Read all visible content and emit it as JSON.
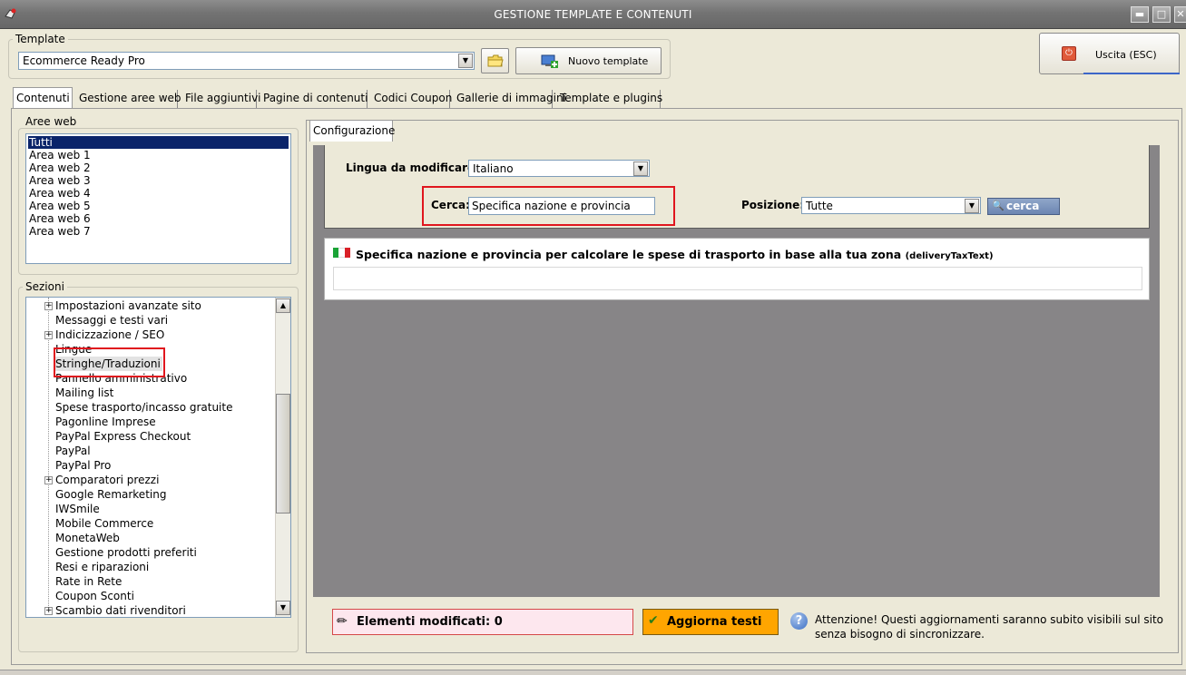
{
  "window": {
    "title": "GESTIONE TEMPLATE E CONTENUTI",
    "min_glyph": "▬",
    "max_glyph": "□",
    "close_glyph": "✕"
  },
  "template": {
    "group_label": "Template",
    "selected": "Ecommerce Ready Pro",
    "new_button": "Nuovo template",
    "exit_button": "Uscita (ESC)"
  },
  "tabs": [
    {
      "label": "Contenuti",
      "active": true
    },
    {
      "label": "Gestione aree web"
    },
    {
      "label": "File aggiuntivi"
    },
    {
      "label": "Pagine di contenuti"
    },
    {
      "label": "Codici Coupon"
    },
    {
      "label": "Gallerie di immagini"
    },
    {
      "label": "Template e plugins"
    }
  ],
  "aree_web": {
    "label": "Aree web",
    "items": [
      "Tutti",
      "Area web 1",
      "Area web 2",
      "Area web 3",
      "Area web 4",
      "Area web 5",
      "Area web 6",
      "Area web 7"
    ],
    "selected_index": 0
  },
  "sezioni": {
    "label": "Sezioni",
    "items": [
      {
        "label": "Impostazioni avanzate sito",
        "expandable": true
      },
      {
        "label": "Messaggi e testi vari"
      },
      {
        "label": "Indicizzazione / SEO",
        "expandable": true
      },
      {
        "label": "Lingue"
      },
      {
        "label": "Stringhe/Traduzioni",
        "selected": true
      },
      {
        "label": "Pannello amministrativo"
      },
      {
        "label": "Mailing list"
      },
      {
        "label": "Spese trasporto/incasso gratuite"
      },
      {
        "label": "Pagonline Imprese"
      },
      {
        "label": "PayPal Express Checkout"
      },
      {
        "label": "PayPal"
      },
      {
        "label": "PayPal Pro"
      },
      {
        "label": "Comparatori prezzi",
        "expandable": true
      },
      {
        "label": "Google Remarketing"
      },
      {
        "label": "IWSmile"
      },
      {
        "label": "Mobile Commerce"
      },
      {
        "label": "MonetaWeb"
      },
      {
        "label": "Gestione prodotti preferiti"
      },
      {
        "label": "Resi e riparazioni"
      },
      {
        "label": "Rate in Rete"
      },
      {
        "label": "Coupon Sconti"
      },
      {
        "label": "Scambio dati rivenditori",
        "expandable": true
      }
    ]
  },
  "config": {
    "tab_label": "Configurazione",
    "language_label": "Lingua da modificare:",
    "language_value": "Italiano",
    "search_label": "Cerca:",
    "search_value": "Specifica nazione e provincia",
    "position_label": "Posizione:",
    "position_value": "Tutte",
    "search_button": "cerca",
    "result_text": "Specifica nazione e provincia per calcolare le spese di trasporto in base alla tua zona",
    "result_key": "(deliveryTaxText)",
    "result_value": ""
  },
  "footer": {
    "modified_label": "Elementi modificati: 0",
    "update_button": "Aggiorna testi",
    "notice": "Attenzione! Questi aggiornamenti saranno subito visibili sul sito senza bisogno di sincronizzare."
  },
  "colors": {
    "titlebar": "#737373",
    "selection": "#0a246a",
    "highlight_border": "#e0161e",
    "update_button": "#ffa500",
    "modified_box_bg": "#fde7ee",
    "config_bg": "#878587"
  }
}
